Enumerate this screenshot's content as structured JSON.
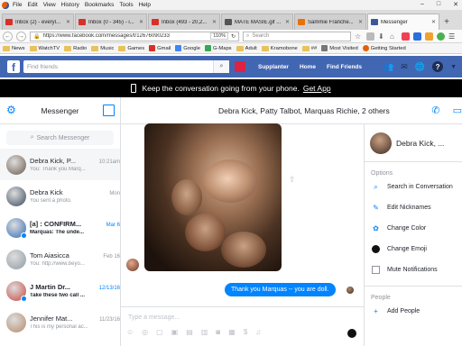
{
  "browser": {
    "menu": [
      "File",
      "Edit",
      "View",
      "History",
      "Bookmarks",
      "Tools",
      "Help"
    ],
    "tabs": [
      {
        "label": "Inbox (2) - everyl...",
        "color": "#d93025"
      },
      {
        "label": "Inbox (0 - 345) - i...",
        "color": "#d93025"
      },
      {
        "label": "Inbox (493 - 20,2...",
        "color": "#d93025"
      },
      {
        "label": "MATE MASIE.gif ...",
        "color": "#555555"
      },
      {
        "label": "Sammie Franche...",
        "color": "#e8710a"
      },
      {
        "label": "Messenger",
        "color": "#3b5998",
        "active": true
      }
    ],
    "url": "https://www.facebook.com/messages/t/12676090233",
    "zoom": "110%",
    "search_placeholder": "Search",
    "bookmarks": [
      "News",
      "WatchTV",
      "Radio",
      "Music",
      "Games",
      "Gmail",
      "Google",
      "G-Maps",
      "Adult",
      "Kramobone",
      "##",
      "Most Visited",
      "Getting Started"
    ]
  },
  "fb": {
    "logo": "f",
    "search_placeholder": "Find friends",
    "nav": [
      "Supplanter",
      "Home",
      "Find Friends"
    ]
  },
  "banner": {
    "text": "Keep the conversation going from your phone.",
    "link": "Get App"
  },
  "left": {
    "title": "Messenger",
    "search_placeholder": "Search Messenger",
    "conversations": [
      {
        "name": "Debra Kick, P...",
        "time": "10:21am",
        "snippet": "You: Thank you Marq...",
        "color": "#6b5a4e",
        "active": true,
        "bold": false,
        "badge": false
      },
      {
        "name": "Debra Kick",
        "time": "Mon",
        "snippet": "You sent a photo.",
        "color": "#3a4a5e",
        "active": false,
        "bold": false,
        "badge": false
      },
      {
        "name": "[a] : CONFIRM...",
        "time": "Mar 6",
        "snippet": "Marquas: The unde...",
        "color": "#2f6bb7",
        "active": false,
        "bold": true,
        "badge": true
      },
      {
        "name": "Tom Aiasicca",
        "time": "Feb 16",
        "snippet": "You: http://www.beyo...",
        "color": "#8e9aa3",
        "active": false,
        "bold": false,
        "badge": false
      },
      {
        "name": "J Martin Dr...",
        "time": "12/13/16",
        "snippet": "Take these two call ...",
        "color": "#c9453d",
        "active": false,
        "bold": true,
        "badge": true
      },
      {
        "name": "Jennifer Mat...",
        "time": "11/23/16",
        "snippet": "This is my personal ac...",
        "color": "#b58a6a",
        "active": false,
        "bold": false,
        "badge": false
      }
    ]
  },
  "thread": {
    "title": "Debra Kick, Patty Talbot, Marquas Richie, 2 others",
    "message": "Thank you Marquas -- you are doll.",
    "composer_placeholder": "Type a message..."
  },
  "right": {
    "name": "Debra Kick, ...",
    "options_label": "Options",
    "options": [
      {
        "label": "Search in Conversation",
        "icon": "search-icon"
      },
      {
        "label": "Edit Nicknames",
        "icon": "pencil-icon"
      },
      {
        "label": "Change Color",
        "icon": "palette-icon"
      },
      {
        "label": "Change Emoji",
        "icon": "emoji-icon"
      },
      {
        "label": "Mute Notifications",
        "icon": "mute-checkbox-icon"
      }
    ],
    "people_label": "People",
    "add_people": "Add People"
  }
}
